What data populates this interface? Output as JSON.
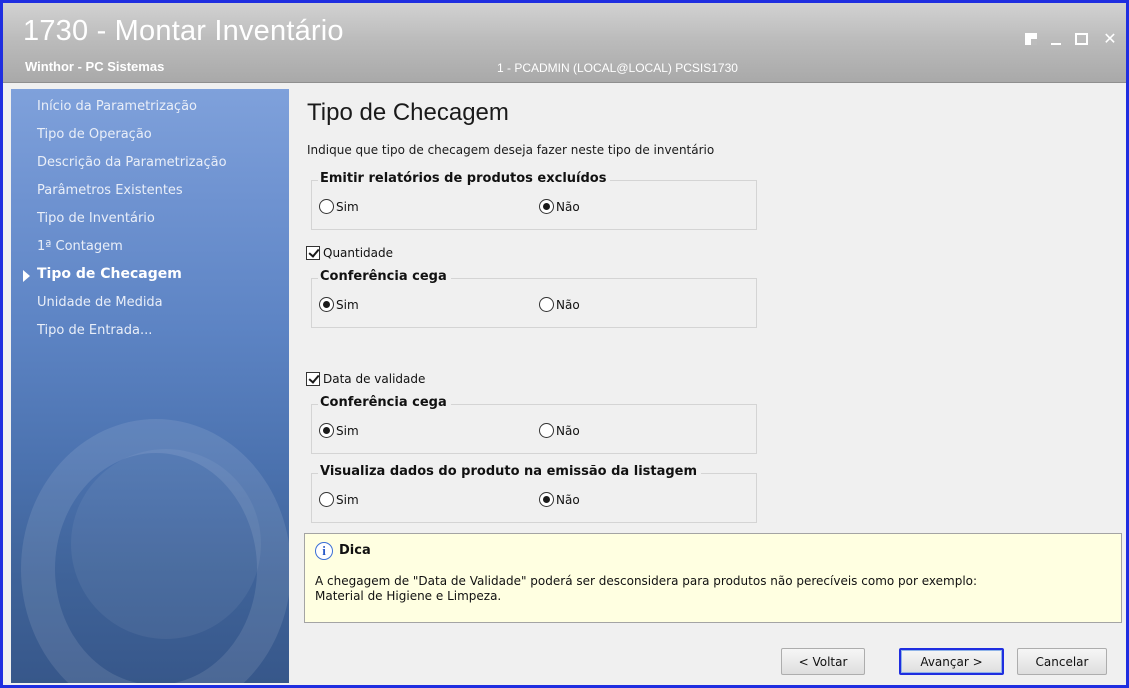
{
  "window": {
    "title": "1730 - Montar Inventário",
    "subtitle": "Winthor - PC Sistemas",
    "user_info": "1 - PCADMIN (LOCAL@LOCAL)   PCSIS1730",
    "controls": [
      "restore-icon",
      "minimize-icon",
      "maximize-icon",
      "close-icon"
    ],
    "close_glyph": "✕"
  },
  "sidebar": {
    "items": [
      {
        "label": "Início da Parametrização"
      },
      {
        "label": "Tipo de Operação"
      },
      {
        "label": "Descrição da Parametrização"
      },
      {
        "label": "Parâmetros Existentes"
      },
      {
        "label": "Tipo de Inventário"
      },
      {
        "label": "1ª Contagem"
      },
      {
        "label": "Tipo de Checagem",
        "active": true
      },
      {
        "label": "Unidade de Medida"
      },
      {
        "label": "Tipo de Entrada..."
      }
    ]
  },
  "main": {
    "title": "Tipo de Checagem",
    "description": "Indique que tipo de checagem deseja fazer neste tipo de inventário",
    "group_excluidos": {
      "title": "Emitir relatórios de produtos excluídos",
      "option_yes": "Sim",
      "option_no": "Não",
      "selected": "Não"
    },
    "check_quantidade": {
      "label": "Quantidade",
      "checked": true
    },
    "group_quantidade_cega": {
      "title": "Conferência cega",
      "option_yes": "Sim",
      "option_no": "Não",
      "selected": "Sim"
    },
    "check_validade": {
      "label": "Data de validade",
      "checked": true
    },
    "group_validade_cega": {
      "title": "Conferência cega",
      "option_yes": "Sim",
      "option_no": "Não",
      "selected": "Sim"
    },
    "group_visualiza": {
      "title": "Visualiza dados do produto na emissão da listagem",
      "option_yes": "Sim",
      "option_no": "Não",
      "selected": "Não"
    },
    "tip": {
      "icon": "info-icon",
      "icon_glyph": "i",
      "title": "Dica",
      "text_line1": "A chegagem de \"Data de Validade\" poderá ser desconsidera para produtos não perecíveis como por exemplo:",
      "text_line2": "Material de Higiene e Limpeza."
    }
  },
  "footer": {
    "back_label": "< Voltar",
    "next_label": "Avançar >",
    "cancel_label": "Cancelar"
  },
  "colors": {
    "window_border": "#1f2ee0",
    "sidebar_top": "#7fa1db",
    "sidebar_bottom": "#37578a",
    "tip_background": "#ffffe1"
  }
}
